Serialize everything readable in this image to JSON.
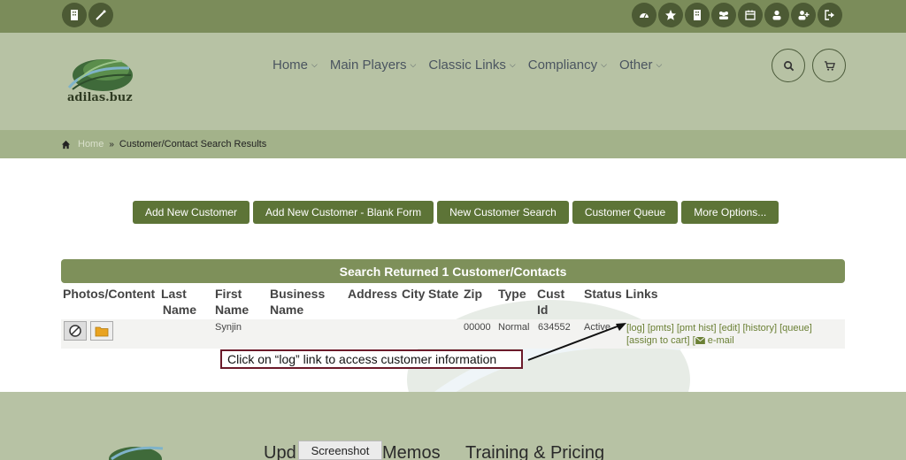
{
  "header": {
    "logo_text": "adilas.buz",
    "nav": [
      {
        "label": "Home"
      },
      {
        "label": "Main Players"
      },
      {
        "label": "Classic Links"
      },
      {
        "label": "Compliancy"
      },
      {
        "label": "Other"
      }
    ]
  },
  "breadcrumb": {
    "home": "Home",
    "separator": "»",
    "current": "Customer/Contact Search Results"
  },
  "actions": [
    "Add New Customer",
    "Add New Customer - Blank Form",
    "New Customer Search",
    "Customer Queue",
    "More Options..."
  ],
  "results": {
    "title": "Search Returned 1 Customer/Contacts",
    "headers": {
      "photos": "Photos/Content",
      "last_name_1": "Last",
      "last_name_2": "Name",
      "first_name_1": "First",
      "first_name_2": "Name",
      "business_1": "Business",
      "business_2": "Name",
      "address": "Address",
      "city": "City",
      "state": "State",
      "zip": "Zip",
      "type": "Type",
      "cust_id_1": "Cust",
      "cust_id_2": "Id",
      "status": "Status",
      "links": "Links"
    },
    "row": {
      "first_name": "Synjin",
      "zip": "00000",
      "type": "Normal",
      "cust_id": "634552",
      "status": "Active",
      "links_line1": [
        "[log]",
        "[pmts]",
        "[pmt hist]",
        "[edit]",
        "[history]",
        "[queue]"
      ],
      "links_line2": [
        "[assign to cart]",
        "e-mail"
      ]
    }
  },
  "callout": "Click on “log” link to access customer information",
  "footer": {
    "item1": "Upd",
    "item2": "Memos",
    "item3": "Training & Pricing",
    "tooltip": "Screenshot"
  },
  "colors": {
    "topbar": "#7b8c5a",
    "header": "#b7c2a4",
    "button": "#5d7437",
    "link": "#6b8035"
  }
}
